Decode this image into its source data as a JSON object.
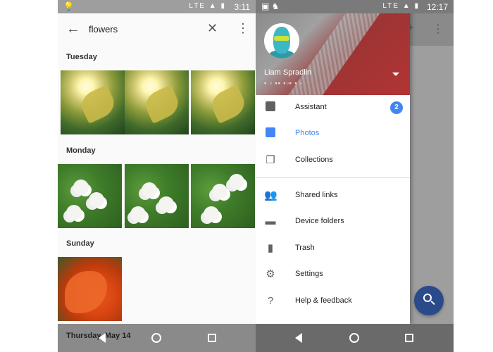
{
  "left": {
    "status_time": "3:11",
    "status_network": "LTE",
    "search_query": "flowers",
    "sections": [
      {
        "label": "Tuesday"
      },
      {
        "label": "Monday"
      },
      {
        "label": "Sunday"
      }
    ],
    "partial_section": "Thursday, May 14"
  },
  "right": {
    "status_time": "12:17",
    "status_network": "LTE",
    "account_name": "Liam Spradlin",
    "menu": [
      {
        "label": "Assistant",
        "icon": "assistant-icon",
        "badge": "2"
      },
      {
        "label": "Photos",
        "icon": "photos-icon",
        "active": true
      },
      {
        "label": "Collections",
        "icon": "collections-icon"
      },
      {
        "label": "Shared links",
        "icon": "people-icon"
      },
      {
        "label": "Device folders",
        "icon": "folder-icon"
      },
      {
        "label": "Trash",
        "icon": "trash-icon"
      },
      {
        "label": "Settings",
        "icon": "gear-icon"
      },
      {
        "label": "Help & feedback",
        "icon": "help-icon"
      }
    ],
    "accent_color": "#4285f4"
  }
}
